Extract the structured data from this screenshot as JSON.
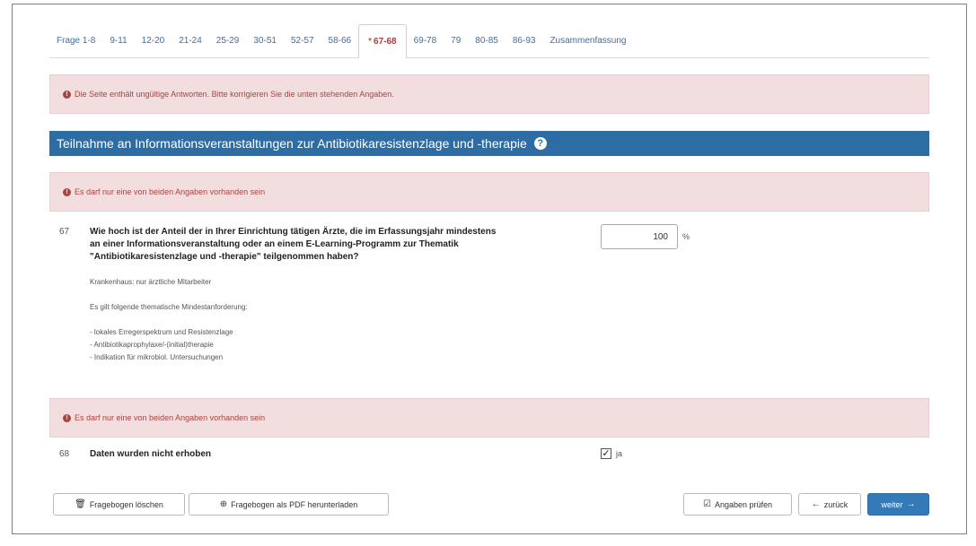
{
  "tabs": [
    {
      "label": "Frage 1-8",
      "active": false
    },
    {
      "label": "9-11",
      "active": false
    },
    {
      "label": "12-20",
      "active": false
    },
    {
      "label": "21-24",
      "active": false
    },
    {
      "label": "25-29",
      "active": false
    },
    {
      "label": "30-51",
      "active": false
    },
    {
      "label": "52-57",
      "active": false
    },
    {
      "label": "58-66",
      "active": false
    },
    {
      "label": "67-68",
      "active": true,
      "marker": "*"
    },
    {
      "label": "69-78",
      "active": false
    },
    {
      "label": "79",
      "active": false
    },
    {
      "label": "80-85",
      "active": false
    },
    {
      "label": "86-93",
      "active": false
    },
    {
      "label": "Zusammenfassung",
      "active": false
    }
  ],
  "page_alert": "Die Seite enthält ungültige Antworten. Bitte korrigieren Sie die unten stehenden Angaben.",
  "section_title": "Teilnahme an Informationsveranstaltungen zur Antibiotikaresistenzlage und -therapie",
  "alert_67": "Es darf nur eine von beiden Angaben vorhanden sein",
  "q67": {
    "number": "67",
    "line1": "Wie hoch ist der Anteil der in Ihrer Einrichtung tätigen Ärzte, die im Erfassungsjahr mindestens",
    "line2": "an einer Informationsveranstaltung oder an einem E-Learning-Programm zur Thematik",
    "line3": "\"Antibiotikaresistenzlage und -therapie\" teilgenommen haben?",
    "note1": "Krankenhaus: nur ärztliche Mitarbeiter",
    "note2": "Es gilt folgende thematische Mindestanforderung:",
    "bullet1": "- lokales Erregerspektrum und Resistenzlage",
    "bullet2": "- Antibiotikaprophylaxe/-(initial)therapie",
    "bullet3": "- Indikation für mikrobiol. Untersuchungen",
    "value": "100",
    "unit": "%"
  },
  "alert_68": "Es darf nur eine von beiden Angaben vorhanden sein",
  "q68": {
    "number": "68",
    "text": "Daten wurden nicht erhoben",
    "checked": true,
    "checkbox_label": "ja"
  },
  "buttons": {
    "delete": "Fragebogen löschen",
    "pdf": "Fragebogen als PDF herunterladen",
    "check": "Angaben prüfen",
    "back": "zurück",
    "next": "weiter"
  },
  "icons": {
    "delete": "trash-icon",
    "pdf": "download-icon",
    "check": "check-edit-icon",
    "back": "arrow-left-icon",
    "next": "arrow-right-icon",
    "alert": "exclamation-circle-icon",
    "help": "question-circle-icon"
  },
  "colors": {
    "section_bar": "#2d6da3",
    "alert_bg": "#f2dede",
    "alert_text": "#a94442",
    "primary_button": "#337ab7"
  }
}
